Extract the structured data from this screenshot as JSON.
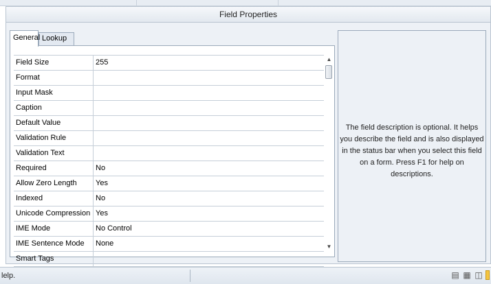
{
  "panel": {
    "title": "Field Properties"
  },
  "tabs": [
    {
      "label": "General"
    },
    {
      "label": "Lookup"
    }
  ],
  "properties": [
    {
      "label": "Field Size",
      "value": "255"
    },
    {
      "label": "Format",
      "value": ""
    },
    {
      "label": "Input Mask",
      "value": ""
    },
    {
      "label": "Caption",
      "value": ""
    },
    {
      "label": "Default Value",
      "value": ""
    },
    {
      "label": "Validation Rule",
      "value": ""
    },
    {
      "label": "Validation Text",
      "value": ""
    },
    {
      "label": "Required",
      "value": "No"
    },
    {
      "label": "Allow Zero Length",
      "value": "Yes"
    },
    {
      "label": "Indexed",
      "value": "No"
    },
    {
      "label": "Unicode Compression",
      "value": "Yes"
    },
    {
      "label": "IME Mode",
      "value": "No Control"
    },
    {
      "label": "IME Sentence Mode",
      "value": "None"
    },
    {
      "label": "Smart Tags",
      "value": ""
    }
  ],
  "scrollbar": {
    "up_icon": "arrow-up-icon",
    "down_icon": "arrow-down-icon"
  },
  "description": {
    "text": "The field description is optional. It helps you describe the field and is also displayed in the status bar when you select this field on a form. Press F1 for help on descriptions."
  },
  "status": {
    "text": "lelp.",
    "view_icons": [
      "datasheet-view-icon",
      "pivot-view-icon",
      "design-view-icon"
    ]
  }
}
